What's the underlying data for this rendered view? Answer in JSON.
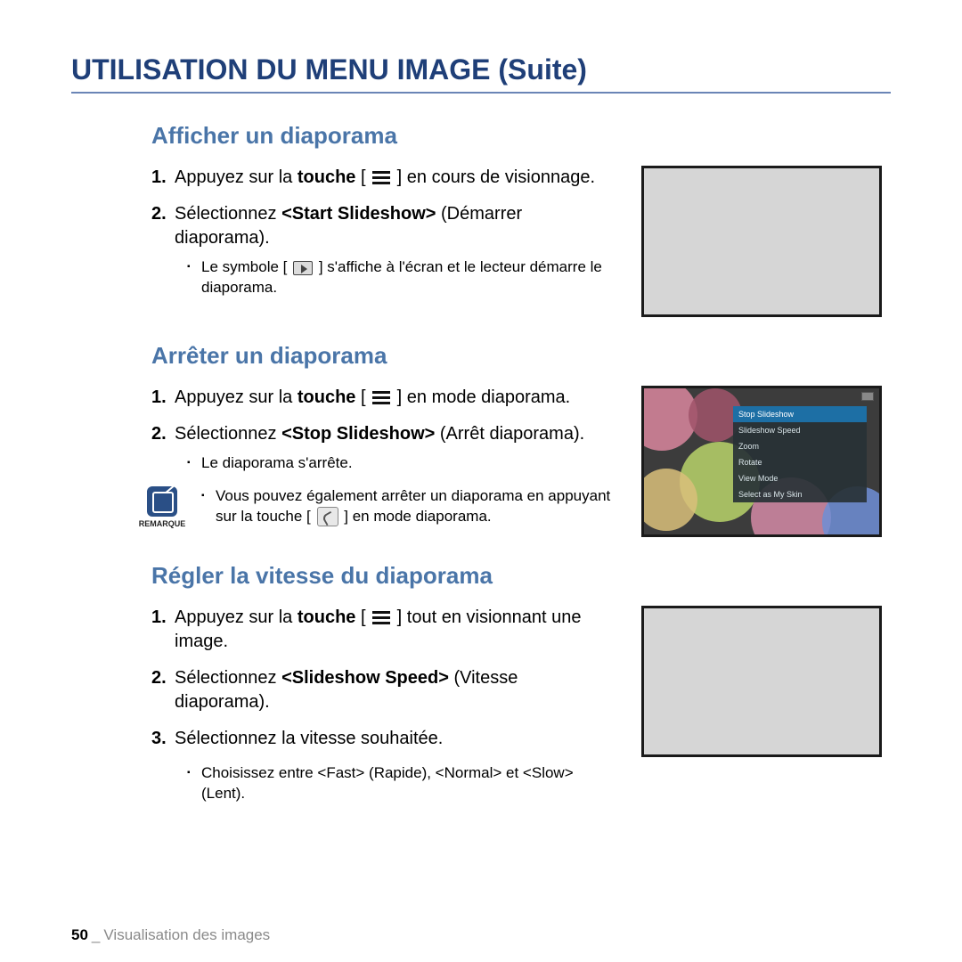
{
  "page_title": "UTILISATION DU MENU IMAGE (Suite)",
  "sections": {
    "show": {
      "title": "Afficher un diaporama",
      "step1_a": "Appuyez sur la ",
      "step1_b": "touche",
      "step1_c": " [",
      "step1_d": "] en cours de visionnage.",
      "step2_a": "Sélectionnez ",
      "step2_b": "<Start Slideshow>",
      "step2_c": " (Démarrer diaporama).",
      "sub1_a": "Le symbole [",
      "sub1_b": "] s'affiche à l'écran et le lecteur démarre le diaporama."
    },
    "stop": {
      "title": "Arrêter un diaporama",
      "step1_a": "Appuyez sur la ",
      "step1_b": "touche",
      "step1_c": " [",
      "step1_d": "] en mode diaporama.",
      "step2_a": "Sélectionnez ",
      "step2_b": "<Stop Slideshow>",
      "step2_c": " (Arrêt diaporama).",
      "sub1": "Le diaporama s'arrête.",
      "note_label": "REMARQUE",
      "note_a": "Vous pouvez également arrêter un diaporama en appuyant sur la touche [",
      "note_b": "] en mode diaporama."
    },
    "speed": {
      "title": "Régler la vitesse du diaporama",
      "step1_a": "Appuyez sur la ",
      "step1_b": "touche",
      "step1_c": " [",
      "step1_d": "] tout en visionnant une image.",
      "step2_a": "Sélectionnez ",
      "step2_b": "<Slideshow Speed>",
      "step2_c": " (Vitesse diaporama).",
      "step3": "Sélectionnez la vitesse souhaitée.",
      "sub1": "Choisissez entre <Fast> (Rapide), <Normal> et <Slow> (Lent)."
    }
  },
  "screenshot_menu": {
    "items": [
      "Stop Slideshow",
      "Slideshow Speed",
      "Zoom",
      "Rotate",
      "View Mode",
      "Select as My Skin"
    ]
  },
  "footer": {
    "page": "50",
    "chapter": "Visualisation des images"
  }
}
